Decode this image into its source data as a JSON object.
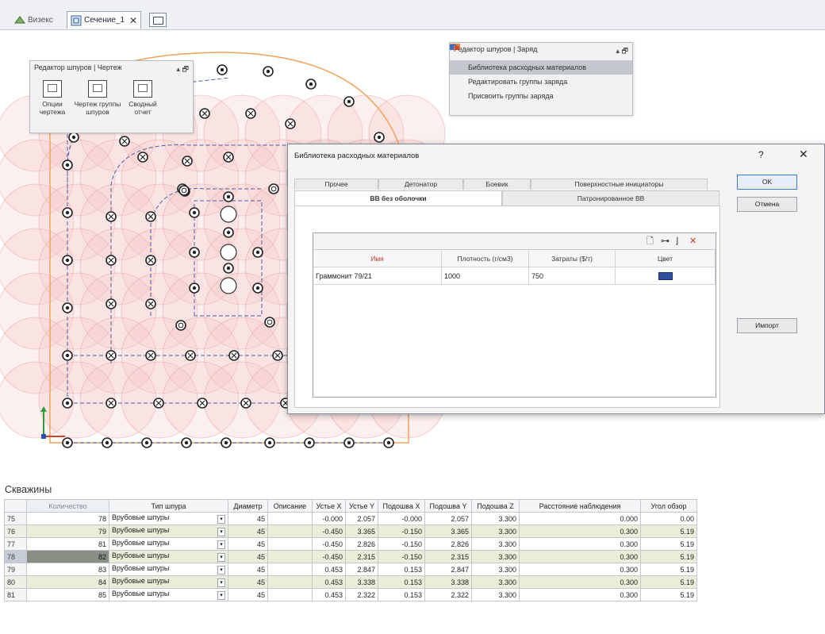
{
  "tabs": [
    {
      "label": "Визекс",
      "active": false
    },
    {
      "label": "Сечение_1",
      "active": true
    }
  ],
  "drawing_panel": {
    "title": "Редактор шпуров | Чертеж",
    "pin": "▴ 🗗",
    "tools": [
      {
        "label_line1": "Опции",
        "label_line2": "чертежа"
      },
      {
        "label_line1": "Чертеж группы",
        "label_line2": "шпуров"
      },
      {
        "label_line1": "Сводный",
        "label_line2": "отчет"
      }
    ]
  },
  "charge_panel": {
    "title": "Редактор шпуров | Заряд",
    "pin": "▴ 🗗",
    "items": [
      {
        "label": "Библиотека расходных материалов",
        "icon": "library-icon",
        "highlighted": true
      },
      {
        "label": "Редактировать группы заряда",
        "icon": "edit-groups-icon",
        "highlighted": false
      },
      {
        "label": "Присвоить группы заряда",
        "icon": "assign-groups-icon",
        "highlighted": false
      }
    ]
  },
  "dialog": {
    "title": "Библиотека расходных материалов",
    "help": "?",
    "close": "✕",
    "tabs_top": [
      "Прочее",
      "Детонатор",
      "Боевик",
      "Поверхностные инициаторы"
    ],
    "tabs_bottom": [
      {
        "label": "ВВ без оболочки",
        "selected": true
      },
      {
        "label": "Патронированное ВВ",
        "selected": false
      }
    ],
    "grid": {
      "columns": [
        "Имя",
        "Плотность (г/см3)",
        "Затраты ($/т)",
        "Цвет"
      ],
      "rows": [
        {
          "name": "Граммонит 79/21",
          "density": "1000",
          "cost": "750",
          "color": "#2f4fa0"
        }
      ]
    },
    "buttons": {
      "ok": "OK",
      "cancel": "Отмена",
      "import": "Импорт"
    }
  },
  "wells": {
    "title": "Скважины",
    "columns": [
      "",
      "Количество",
      "Тип шпура",
      "Диаметр",
      "Описание",
      "Устье X",
      "Устье Y",
      "Подошва X",
      "Подошва Y",
      "Подошва Z",
      "Расстояние наблюдения",
      "Угол обзор"
    ],
    "rows": [
      {
        "n": "75",
        "count": "78",
        "type": "Врубовые шпуры",
        "d": "45",
        "desc": "",
        "ux": "-0.000",
        "uy": "2.057",
        "px": "-0.000",
        "py": "2.057",
        "pz": "3.300",
        "dist": "0.000",
        "angle": "0.00"
      },
      {
        "n": "76",
        "count": "79",
        "type": "Врубовые шпуры",
        "d": "45",
        "desc": "",
        "ux": "-0.450",
        "uy": "3.365",
        "px": "-0.150",
        "py": "3.365",
        "pz": "3.300",
        "dist": "0.300",
        "angle": "5.19"
      },
      {
        "n": "77",
        "count": "81",
        "type": "Врубовые шпуры",
        "d": "45",
        "desc": "",
        "ux": "-0.450",
        "uy": "2.826",
        "px": "-0.150",
        "py": "2.826",
        "pz": "3.300",
        "dist": "0.300",
        "angle": "5.19"
      },
      {
        "n": "78",
        "count": "82",
        "type": "Врубовые шпуры",
        "d": "45",
        "desc": "",
        "ux": "-0.450",
        "uy": "2.315",
        "px": "-0.150",
        "py": "2.315",
        "pz": "3.300",
        "dist": "0.300",
        "angle": "5.19"
      },
      {
        "n": "79",
        "count": "83",
        "type": "Врубовые шпуры",
        "d": "45",
        "desc": "",
        "ux": "0.453",
        "uy": "2.847",
        "px": "0.153",
        "py": "2.847",
        "pz": "3.300",
        "dist": "0.300",
        "angle": "5.19"
      },
      {
        "n": "80",
        "count": "84",
        "type": "Врубовые шпуры",
        "d": "45",
        "desc": "",
        "ux": "0.453",
        "uy": "3.338",
        "px": "0.153",
        "py": "3.338",
        "pz": "3.300",
        "dist": "0.300",
        "angle": "5.19"
      },
      {
        "n": "81",
        "count": "85",
        "type": "Врубовые шпуры",
        "d": "45",
        "desc": "",
        "ux": "0.453",
        "uy": "2.322",
        "px": "0.153",
        "py": "2.322",
        "pz": "3.300",
        "dist": "0.300",
        "angle": "5.19"
      }
    ],
    "selected_row": "78",
    "dropdown_glyph": "▾"
  },
  "colors": {
    "contour": "#f0a35a",
    "coverage": "#f5c6c6",
    "hole_line": "#4a5fa8",
    "accent": "#3b78d8"
  }
}
